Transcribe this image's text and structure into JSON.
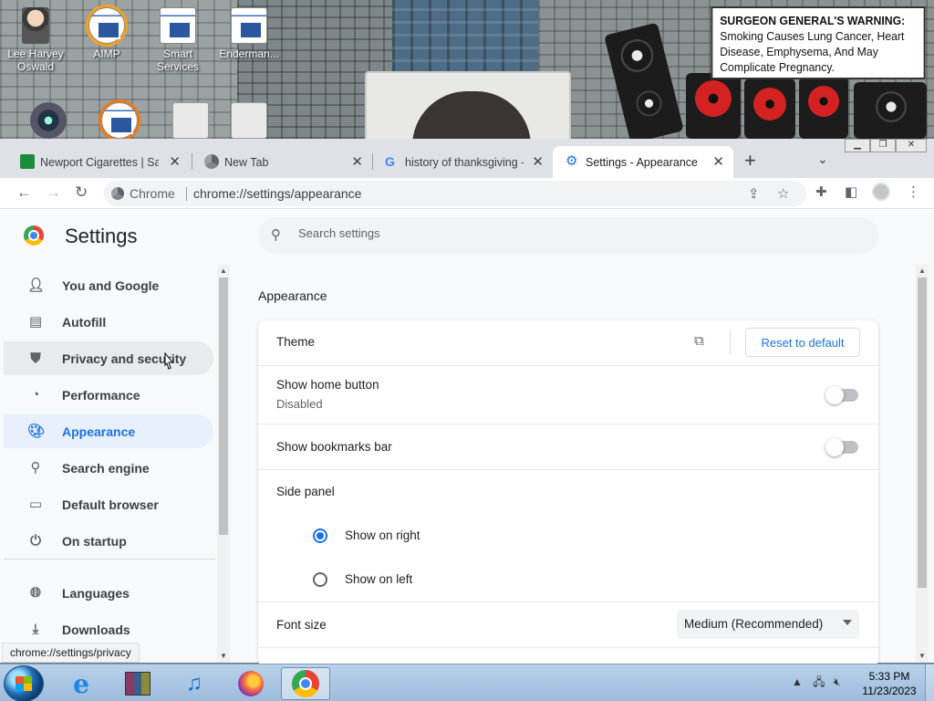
{
  "desktop": {
    "icons": [
      {
        "label": "Lee Harvey\nOswald",
        "icon": "person-icon"
      },
      {
        "label": "AIMP",
        "icon": "aimp-icon"
      },
      {
        "label": "Smart\nServices",
        "icon": "smart-services-icon"
      },
      {
        "label": "Enderman...",
        "icon": "enderman-icon"
      }
    ],
    "warning_bold": "SURGEON GENERAL'S WARNING:",
    "warning_text": " Smoking Causes Lung Cancer, Heart Disease, Emphysema, And May Complicate Pregnancy."
  },
  "tabs": [
    {
      "title": "Newport Cigarettes | Sav",
      "icon": "newport-favicon",
      "active": false
    },
    {
      "title": "New Tab",
      "icon": "chrome-favicon",
      "active": false
    },
    {
      "title": "history of thanksgiving -",
      "icon": "google-favicon",
      "active": false
    },
    {
      "title": "Settings - Appearance",
      "icon": "settings-gear-favicon",
      "active": true
    }
  ],
  "toolbar": {
    "chip_label": "Chrome",
    "url": "chrome://settings/appearance"
  },
  "settings": {
    "title": "Settings",
    "search_placeholder": "Search settings",
    "nav": [
      {
        "label": "You and Google",
        "icon": "person-icon"
      },
      {
        "label": "Autofill",
        "icon": "clipboard-icon"
      },
      {
        "label": "Privacy and security",
        "icon": "shield-icon"
      },
      {
        "label": "Performance",
        "icon": "speedometer-icon"
      },
      {
        "label": "Appearance",
        "icon": "palette-icon"
      },
      {
        "label": "Search engine",
        "icon": "search-icon"
      },
      {
        "label": "Default browser",
        "icon": "browser-window-icon"
      },
      {
        "label": "On startup",
        "icon": "power-icon"
      },
      {
        "label": "Languages",
        "icon": "globe-icon"
      },
      {
        "label": "Downloads",
        "icon": "download-icon"
      }
    ],
    "active_nav": "Appearance",
    "hovered_nav": "Privacy and security",
    "section_title": "Appearance",
    "theme_label": "Theme",
    "reset_button": "Reset to default",
    "home_button_label": "Show home button",
    "home_button_status": "Disabled",
    "bookmarks_bar_label": "Show bookmarks bar",
    "side_panel_label": "Side panel",
    "side_panel_options": [
      "Show on right",
      "Show on left"
    ],
    "side_panel_selected": "Show on right",
    "font_size_label": "Font size",
    "font_size_value": "Medium (Recommended)"
  },
  "status_url": "chrome://settings/privacy",
  "taskbar": {
    "time": "5:33 PM",
    "date": "11/23/2023",
    "pinned": [
      "internet-explorer-icon",
      "file-archive-icon",
      "music-icon",
      "firefox-icon",
      "chrome-icon"
    ]
  },
  "colors": {
    "accent": "#1a73e8",
    "active_nav_bg": "#e8f0fe"
  }
}
